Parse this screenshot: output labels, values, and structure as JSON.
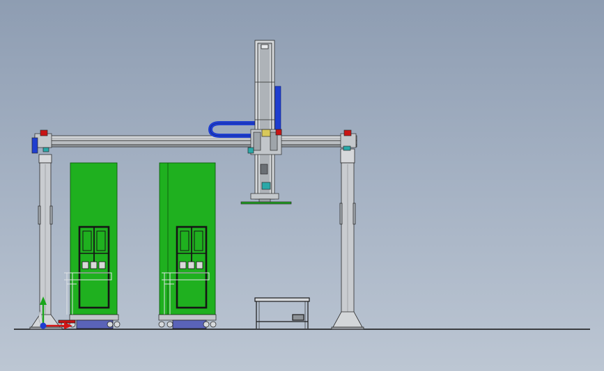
{
  "scene": {
    "kind": "cad-model-view",
    "view": "front",
    "background": {
      "top": "#8e9db2",
      "bottom": "#bcc6d3"
    },
    "colors": {
      "frame": "#c9ccd0",
      "frame_edge": "#2a2a2a",
      "cabinet": "#1fb01f",
      "cabinet_edge": "#0e5e0e",
      "cable_chain": "#1f3ecf",
      "motor_red": "#c81414",
      "base_blue": "#5a63b8",
      "teal": "#2aa8a8",
      "floor": "#101010"
    },
    "components": {
      "gantry": {
        "columns": 2,
        "crossbeam": true
      },
      "z_axis": {
        "cable_chain": true
      },
      "storage_cabinets": 2,
      "workbench": 1
    },
    "triad": {
      "axes": [
        "x",
        "y",
        "z"
      ]
    }
  }
}
